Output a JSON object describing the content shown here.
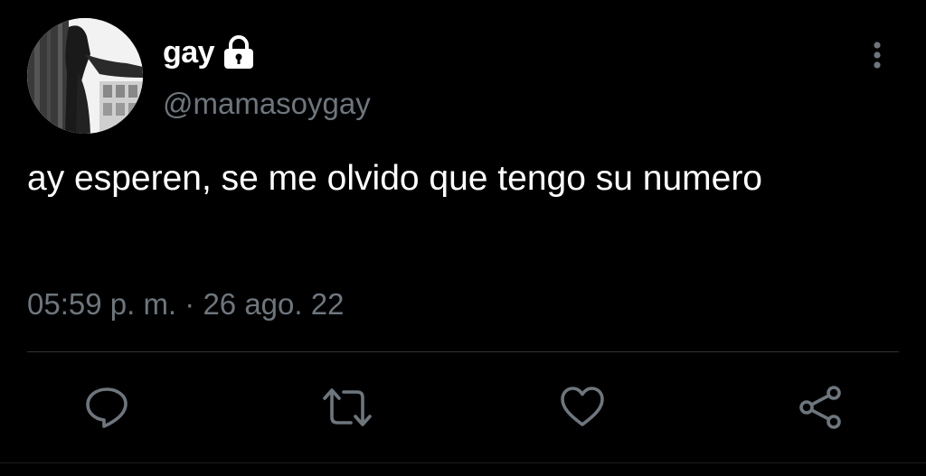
{
  "tweet": {
    "display_name": "gay",
    "handle": "@mamasoygay",
    "text": "ay esperen, se me olvido que tengo su numero",
    "time": "05:59 p. m.",
    "separator": "·",
    "date": "26 ago. 22"
  },
  "icons": {
    "lock": "lock-icon",
    "more": "more-vertical-icon",
    "reply": "reply-icon",
    "retweet": "retweet-icon",
    "like": "heart-icon",
    "share": "share-icon"
  },
  "colors": {
    "background": "#000000",
    "text_primary": "#ffffff",
    "text_secondary": "#6e767d",
    "divider": "#2f3336",
    "icon": "#6e767d"
  }
}
